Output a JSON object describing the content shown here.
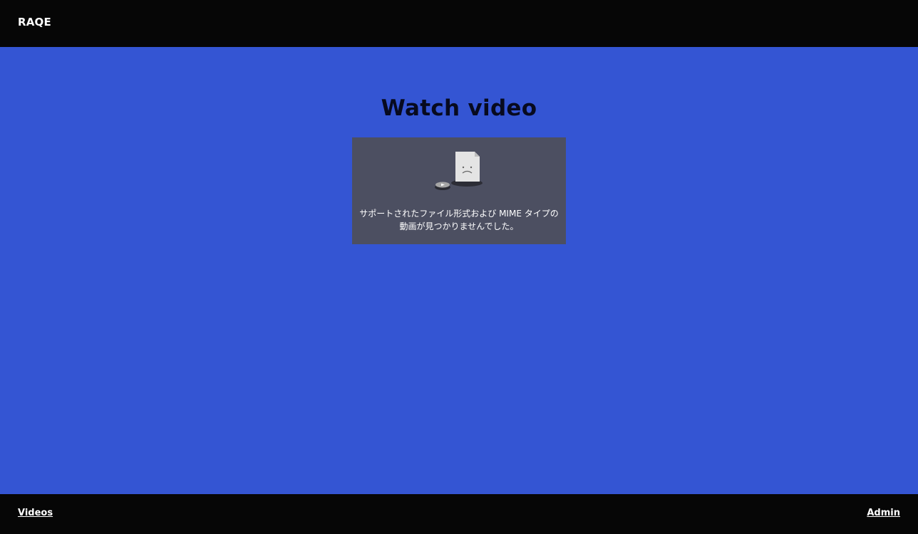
{
  "header": {
    "brand": "RAQE"
  },
  "main": {
    "title": "Watch video",
    "video": {
      "error_message": "サポートされたファイル形式および MIME タイプの動画が見つかりませんでした。",
      "icon": "broken-video-file-icon"
    }
  },
  "footer": {
    "videos_link": "Videos",
    "admin_link": "Admin"
  },
  "colors": {
    "background": "#3455d3",
    "bars": "#060606",
    "player": "#4c4f61"
  }
}
